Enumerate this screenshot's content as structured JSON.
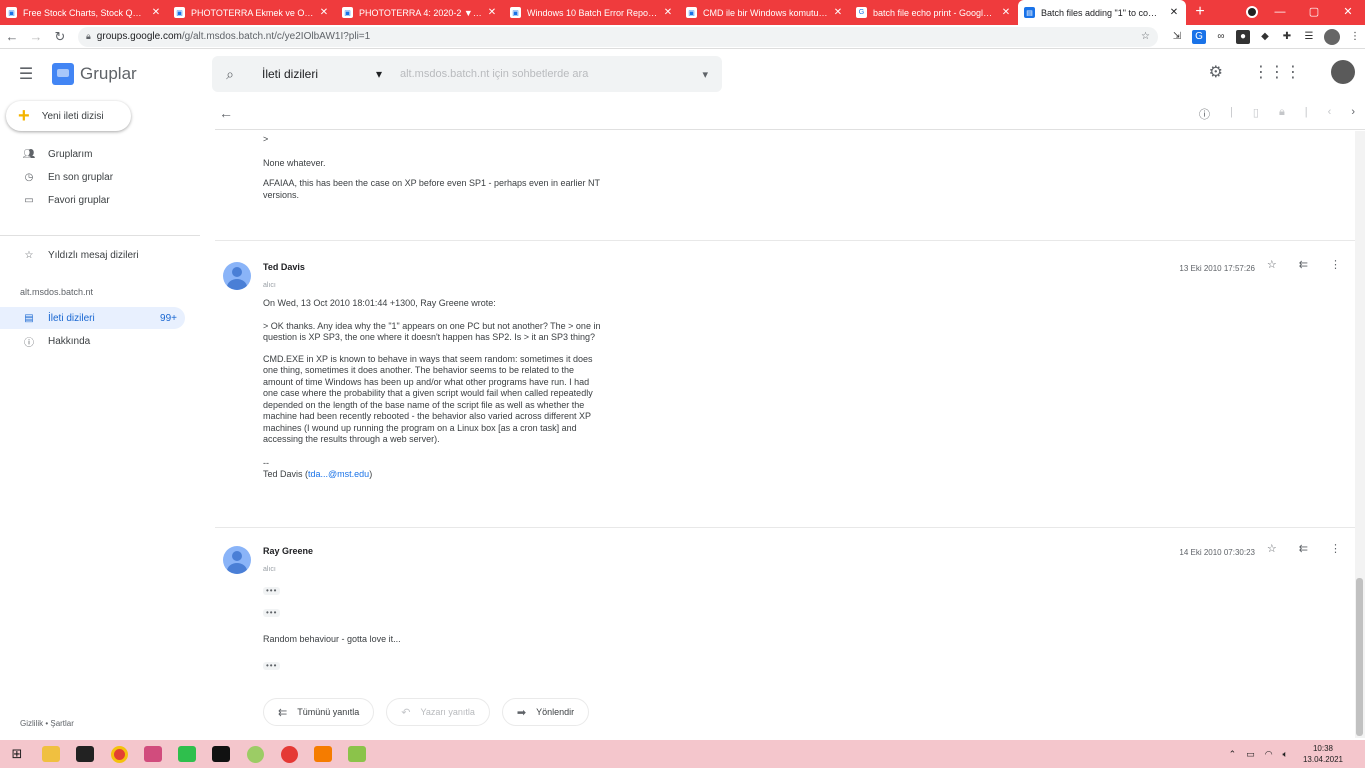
{
  "browser": {
    "tabs": [
      {
        "title": "Free Stock Charts, Stock Quote",
        "active": false
      },
      {
        "title": "PHOTOTERRA Ekmek ve Oyun...",
        "active": false
      },
      {
        "title": "PHOTOTERRA 4: 2020-2 ▼ \u0007 | 300",
        "active": false
      },
      {
        "title": "Windows 10 Batch Error Repor...",
        "active": false
      },
      {
        "title": "CMD ile bir Windows komutunu...",
        "active": false
      },
      {
        "title": "batch file echo print - Google'da",
        "active": false
      },
      {
        "title": "Batch files adding \"1\" to comma...",
        "active": true
      }
    ],
    "url_host": "groups.google.com",
    "url_path": "/g/alt.msdos.batch.nt/c/ye2IOlbAW1I?pli=1"
  },
  "app": {
    "name": "Gruplar",
    "search_scope": "İleti dizileri",
    "search_placeholder": "alt.msdos.batch.nt için sohbetlerde ara"
  },
  "sidebar": {
    "new_thread": "Yeni ileti dizisi",
    "items": [
      {
        "label": "Gruplarım",
        "icon": "groups-icon"
      },
      {
        "label": "En son gruplar",
        "icon": "clock-icon"
      },
      {
        "label": "Favori gruplar",
        "icon": "folder-icon"
      },
      {
        "label": "Yıldızlı mesaj dizileri",
        "icon": "star-icon"
      }
    ],
    "group_name": "alt.msdos.batch.nt",
    "group_items": [
      {
        "label": "İleti dizileri",
        "count": "99+",
        "icon": "threads-icon"
      },
      {
        "label": "Hakkında",
        "icon": "info-icon"
      }
    ],
    "footer": "Gizlilik • Şartlar"
  },
  "messages": {
    "prev": {
      "quote_marker": ">",
      "line1": "None whatever.",
      "line2": "AFAIAA, this has been the case on XP before even SP1 - perhaps even in earlier NT versions."
    },
    "m1": {
      "author": "Ted Davis",
      "sender": "alıcı",
      "date": "13 Eki 2010 17:57:26",
      "intro": "On Wed, 13 Oct 2010 18:01:44 +1300, Ray Greene wrote:",
      "quote": "> OK thanks. Any idea why the \"1\" appears on one PC but not another? The > one in question is XP SP3, the one where it doesn't happen has SP2. Is > it an SP3 thing?",
      "body": "CMD.EXE in XP is known to behave in ways that seem random: sometimes it does one thing, sometimes it does another. The behavior seems to be related to the amount of time Windows has been up and/or what other programs have run. I had one case where the probability that a given script would fail when called repeatedly depended on the length of the base name of the script file as well as whether the machine had been recently rebooted - the behavior also varied across different XP machines (I wound up running the program on a Linux box [as a cron task] and accessing the results through a web server).",
      "sig_sep": "--",
      "sig_name": "Ted Davis (",
      "sig_email": "tda...@mst.edu",
      "sig_close": ")"
    },
    "m2": {
      "author": "Ray Greene",
      "sender": "alıcı",
      "date": "14 Eki 2010 07:30:23",
      "dots": "•••",
      "body": "Random behaviour - gotta love it..."
    }
  },
  "actions": {
    "reply_all": "Tümünü yanıtla",
    "reply_author": "Yazarı yanıtla",
    "forward": "Yönlendir"
  },
  "clock": {
    "time": "10:38",
    "date": "13.04.2021"
  }
}
